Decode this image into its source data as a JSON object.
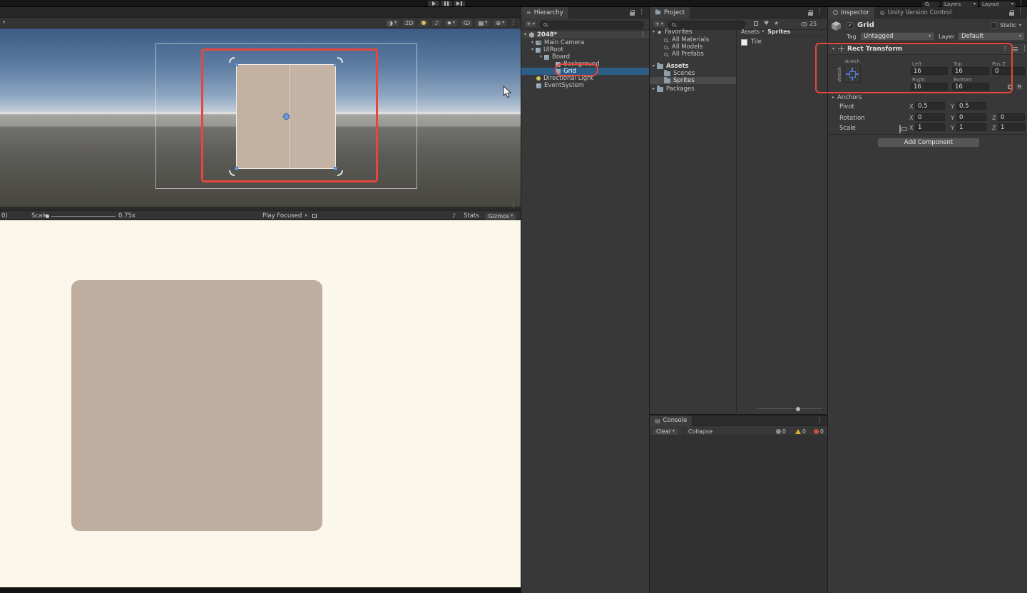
{
  "icons": {
    "chevron_down": "▾",
    "chevron_right": "▸",
    "kebab": "⋮",
    "plus": "+",
    "star": "★",
    "check": "✓",
    "menu": "≡",
    "note": "♪",
    "shaded_sphere": "◑",
    "grid_glyph": "▦",
    "gizmo_glyph": "⊕",
    "fx_glyph": "◆",
    "page_glyph": "▤",
    "vcs_glyph": "◎",
    "help": "?"
  },
  "colors": {
    "annotation": "#e8463c",
    "selection_blue": "#2c5d87",
    "board_tan": "#bfad9f",
    "game_background": "#fbf7eb"
  },
  "top_bar": {
    "layers": "Layers",
    "layout": "Layout"
  },
  "scene_view": {
    "mode_2d": "2D"
  },
  "game_view": {
    "left_truncated": "0)",
    "scale_label": "Scale",
    "scale_value": "0.75x",
    "focus_mode": "Play Focused",
    "stats_label": "Stats",
    "gizmos_label": "Gizmos"
  },
  "hierarchy": {
    "title": "Hierarchy",
    "scene_name": "2048*",
    "items": [
      {
        "label": "Main Camera"
      },
      {
        "label": "UIRoot"
      },
      {
        "label": "Board"
      },
      {
        "label": "Background"
      },
      {
        "label": "Grid"
      },
      {
        "label": "Directional Light"
      },
      {
        "label": "EventSystem"
      }
    ]
  },
  "project": {
    "title": "Project",
    "favorites_label": "Favorites",
    "queries": [
      "All Materials",
      "All Models",
      "All Prefabs"
    ],
    "assets_label": "Assets",
    "folders": [
      "Scenes",
      "Sprites"
    ],
    "packages_label": "Packages",
    "breadcrumb": [
      "Assets",
      "Sprites"
    ],
    "content_items": [
      "Tile"
    ],
    "hidden_count": "25"
  },
  "console": {
    "title": "Console",
    "clear_label": "Clear",
    "collapse_label": "Collapse",
    "counts": {
      "info": "0",
      "warning": "0",
      "error": "0"
    }
  },
  "inspector": {
    "tab_label": "Inspector",
    "vcs_tab_label": "Unity Version Control",
    "object_name": "Grid",
    "static_label": "Static",
    "tag_label": "Tag",
    "tag_value": "Untagged",
    "layer_label": "Layer",
    "layer_value": "Default",
    "rect_transform": {
      "title": "Rect Transform",
      "stretch_top": "stretch",
      "stretch_left": "stretch",
      "left_label": "Left",
      "left_value": "16",
      "top_label": "Top",
      "top_value": "16",
      "posz_label": "Pos Z",
      "posz_value": "0",
      "right_label": "Right",
      "right_value": "16",
      "bottom_label": "Bottom",
      "bottom_value": "16",
      "anchors_label": "Anchors",
      "pivot_label": "Pivot",
      "rotation_label": "Rotation",
      "scale_label": "Scale",
      "axis_x": "X",
      "axis_y": "Y",
      "axis_z": "Z",
      "pivot_x": "0.5",
      "pivot_y": "0.5",
      "rotation_x": "0",
      "rotation_y": "0",
      "rotation_z": "0",
      "scale_x": "1",
      "scale_y": "1",
      "scale_z": "1",
      "raw_edit": "R"
    },
    "add_component_label": "Add Component"
  }
}
